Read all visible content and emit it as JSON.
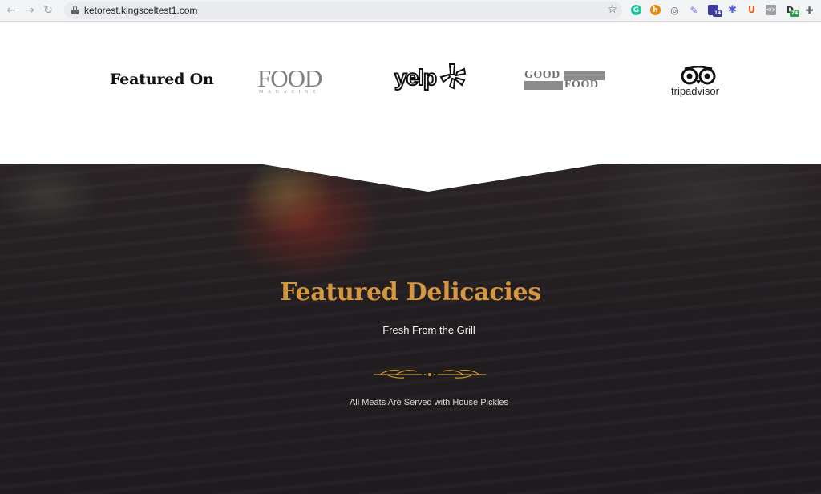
{
  "browser": {
    "url": "ketorest.kingsceltest1.com",
    "back_icon": "arrow-left-icon",
    "forward_icon": "arrow-right-icon",
    "reload_icon": "reload-icon",
    "extensions": [
      {
        "name": "grammarly-icon",
        "color": "#15c39a",
        "glyph": "G"
      },
      {
        "name": "honey-icon",
        "color": "#e8860c",
        "glyph": "h"
      },
      {
        "name": "camera-icon",
        "color": "#5f6368",
        "glyph": "◎"
      },
      {
        "name": "pen-icon",
        "color": "#7b61ff",
        "glyph": "✎"
      },
      {
        "name": "stack-icon",
        "color": "#3c3c9c",
        "glyph": "◆",
        "badge": "14"
      },
      {
        "name": "asterisk-icon",
        "color": "#4f5bd5",
        "glyph": "✱"
      },
      {
        "name": "ublock-icon",
        "color": "#e8590c",
        "glyph": "U"
      },
      {
        "name": "code-icon",
        "color": "#5f6368",
        "glyph": "</>"
      },
      {
        "name": "d-extension-icon",
        "color": "#333333",
        "glyph": "D",
        "badge": "74"
      },
      {
        "name": "puzzle-icon",
        "color": "#5f6368",
        "glyph": "✚"
      }
    ]
  },
  "featured_on": {
    "heading": "Featured On",
    "logos": {
      "food_magazine": {
        "big": "FOOD",
        "small": "MAGAZINE"
      },
      "yelp": {
        "word": "yelp"
      },
      "good_food": {
        "line1": "GOOD",
        "line2": "FOOD"
      },
      "tripadvisor": {
        "word": "tripadvisor"
      }
    }
  },
  "delicacies": {
    "title": "Featured Delicacies",
    "subtitle": "Fresh From the Grill",
    "note": "All Meats Are Served with House Pickles",
    "accent_color": "#d4973d"
  }
}
